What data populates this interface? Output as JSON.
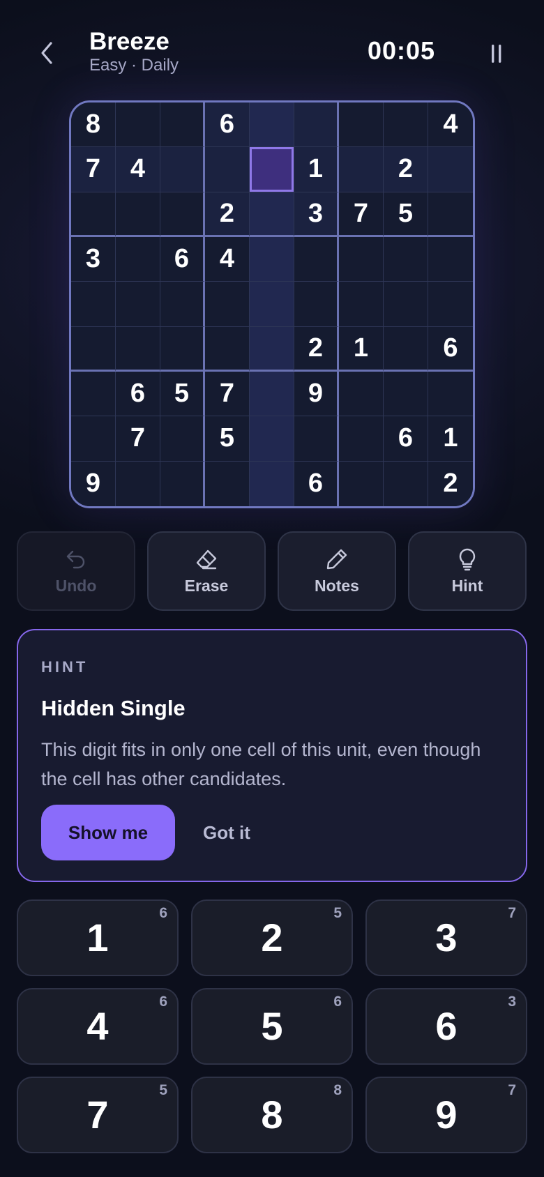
{
  "header": {
    "title": "Breeze",
    "subtitle": "Easy · Daily",
    "timer": "00:05"
  },
  "board": {
    "selected": [
      1,
      4
    ],
    "grid": [
      [
        "8",
        "",
        "",
        "6",
        "",
        "",
        "",
        "",
        "4"
      ],
      [
        "7",
        "4",
        "",
        "",
        "",
        "1",
        "",
        "2",
        ""
      ],
      [
        "",
        "",
        "",
        "2",
        "",
        "3",
        "7",
        "5",
        ""
      ],
      [
        "3",
        "",
        "6",
        "4",
        "",
        "",
        "",
        "",
        ""
      ],
      [
        "",
        "",
        "",
        "",
        "",
        "",
        "",
        "",
        ""
      ],
      [
        "",
        "",
        "",
        "",
        "",
        "2",
        "1",
        "",
        "6"
      ],
      [
        "",
        "6",
        "5",
        "7",
        "",
        "9",
        "",
        "",
        ""
      ],
      [
        "",
        "7",
        "",
        "5",
        "",
        "",
        "",
        "6",
        "1"
      ],
      [
        "9",
        "",
        "",
        "",
        "",
        "6",
        "",
        "",
        "2"
      ]
    ]
  },
  "tools": [
    {
      "label": "Undo",
      "icon": "undo-icon",
      "enabled": false
    },
    {
      "label": "Erase",
      "icon": "eraser-icon",
      "enabled": true
    },
    {
      "label": "Notes",
      "icon": "pencil-icon",
      "enabled": true
    },
    {
      "label": "Hint",
      "icon": "lightbulb-icon",
      "enabled": true
    }
  ],
  "hint": {
    "tag": "HINT",
    "title": "Hidden Single",
    "body": "This digit fits in only one cell of this unit, even though the cell has other candidates.",
    "primary_label": "Show me",
    "secondary_label": "Got it"
  },
  "numpad": [
    {
      "digit": "1",
      "remaining": "6"
    },
    {
      "digit": "2",
      "remaining": "5"
    },
    {
      "digit": "3",
      "remaining": "7"
    },
    {
      "digit": "4",
      "remaining": "6"
    },
    {
      "digit": "5",
      "remaining": "6"
    },
    {
      "digit": "6",
      "remaining": "3"
    },
    {
      "digit": "7",
      "remaining": "5"
    },
    {
      "digit": "8",
      "remaining": "8"
    },
    {
      "digit": "9",
      "remaining": "7"
    }
  ],
  "colors": {
    "accent": "#8a6cfa",
    "background": "#0e1120",
    "board_border": "#7078c0"
  }
}
